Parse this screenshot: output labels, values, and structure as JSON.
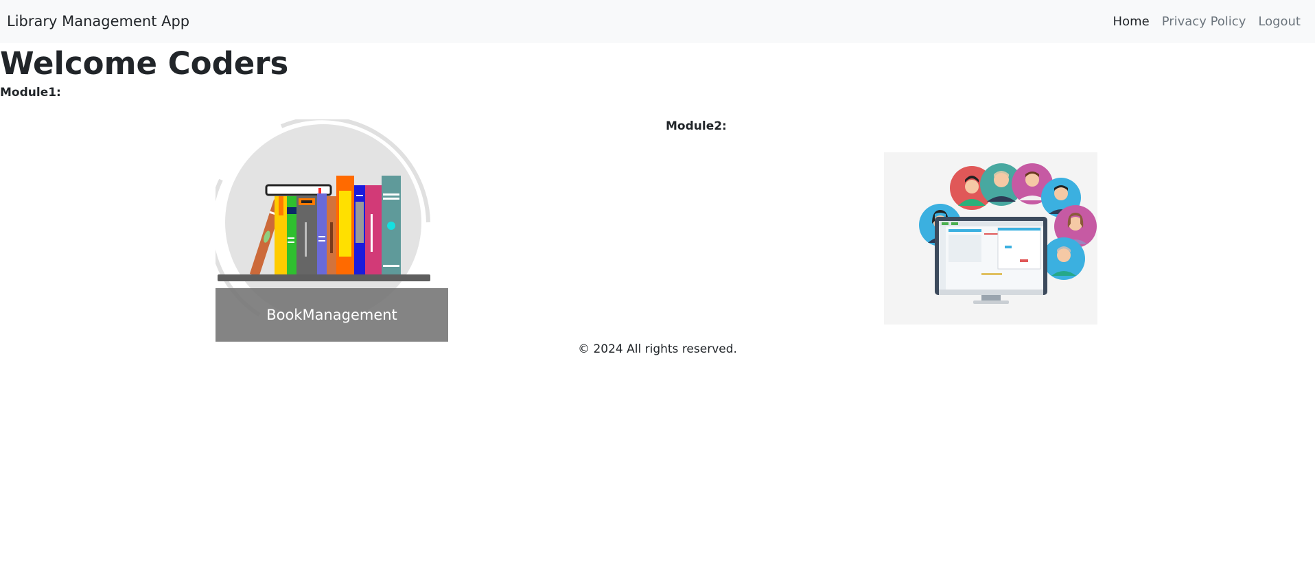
{
  "navbar": {
    "brand": "Library Management App",
    "links": [
      "Home",
      "Privacy Policy",
      "Logout"
    ]
  },
  "main": {
    "heading": "Welcome Coders",
    "modules": [
      {
        "label": "Module1:",
        "caption": "BookManagement"
      },
      {
        "label": "Module2:"
      }
    ]
  },
  "footer": {
    "text": "© 2024 All rights reserved."
  },
  "colors": {
    "navbar_bg": "#f8f9fa",
    "caption_overlay": "#737373",
    "muted_link": "#6c757d"
  },
  "icons": [
    "bookshelf-illustration",
    "people-computer-illustration"
  ]
}
